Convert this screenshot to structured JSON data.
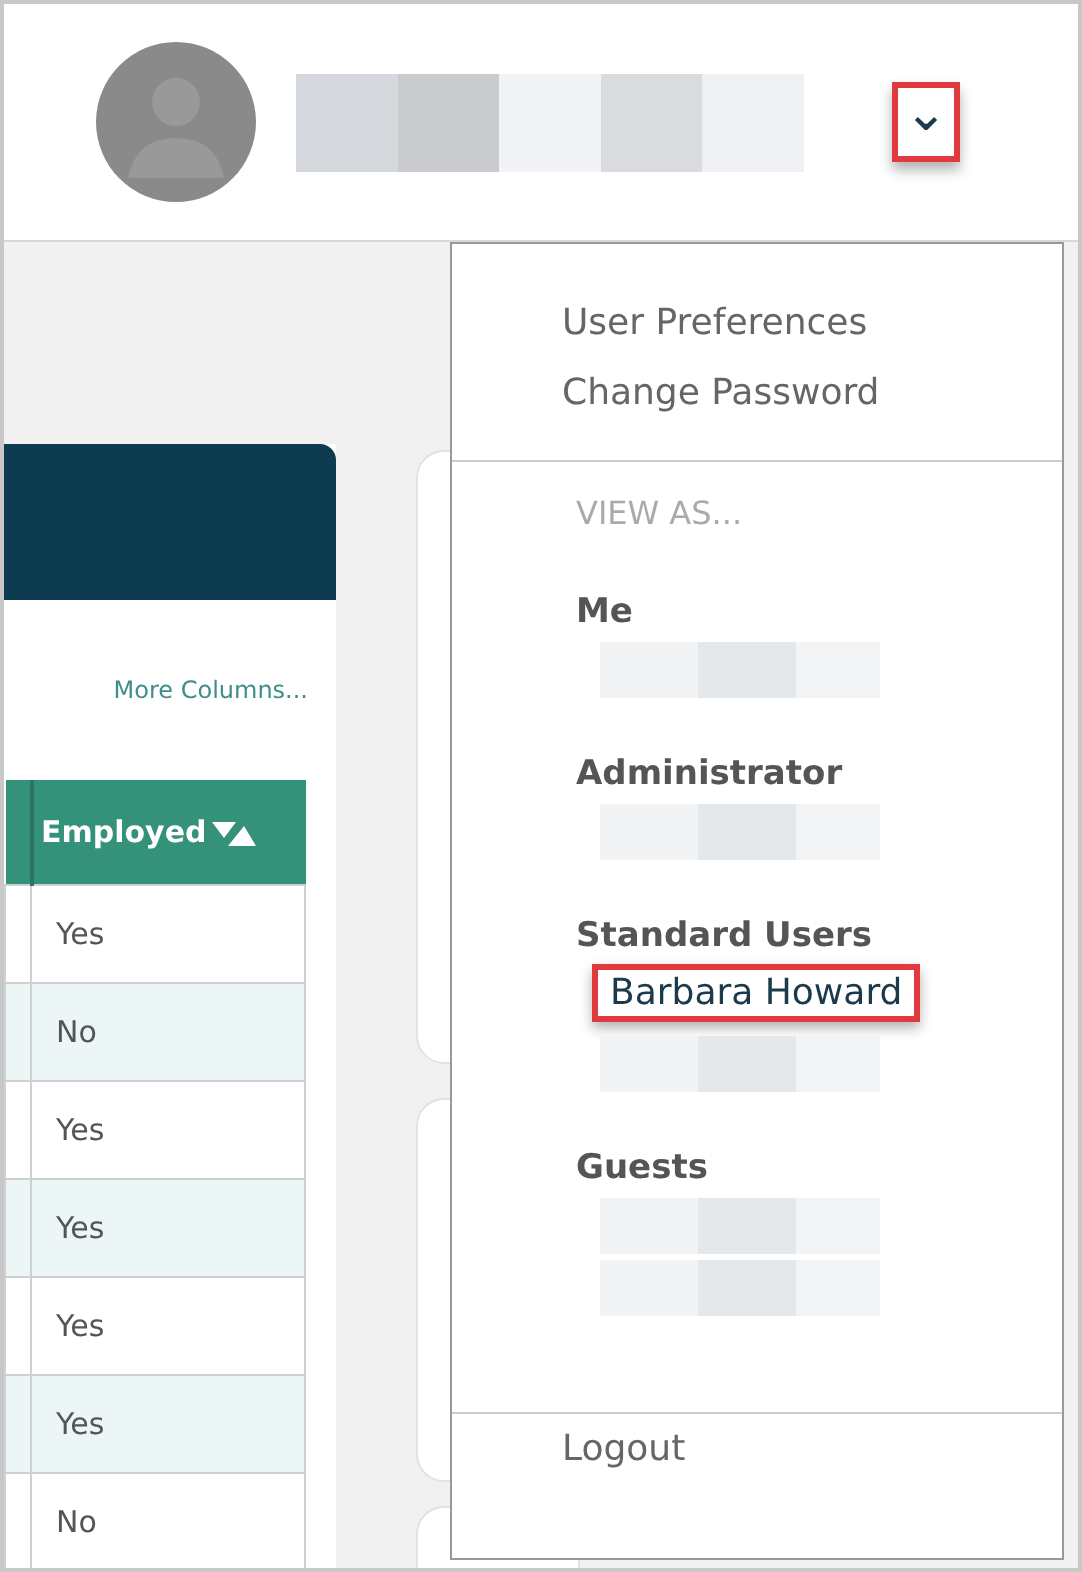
{
  "header": {
    "menu_toggle": {
      "glyph": "⌄",
      "highlighted": true
    }
  },
  "table": {
    "more_columns": "More Columns...",
    "columns": [
      {
        "kind": "stub"
      },
      {
        "label": "Employed",
        "sort_icon": true
      }
    ],
    "rows": [
      {
        "employed": "Yes"
      },
      {
        "employed": "No"
      },
      {
        "employed": "Yes"
      },
      {
        "employed": "Yes"
      },
      {
        "employed": "Yes"
      },
      {
        "employed": "Yes"
      },
      {
        "employed": "No"
      }
    ]
  },
  "dropdown": {
    "links": [
      {
        "label": "User Preferences"
      },
      {
        "label": "Change Password"
      }
    ],
    "view_as_label": "VIEW AS...",
    "groups": [
      {
        "heading": "Me",
        "users": [
          {
            "kind": "redacted"
          }
        ]
      },
      {
        "heading": "Administrator",
        "users": [
          {
            "kind": "redacted"
          }
        ]
      },
      {
        "heading": "Standard Users",
        "users": [
          {
            "kind": "name",
            "label": "Barbara Howard",
            "highlighted": true
          },
          {
            "kind": "redacted"
          }
        ]
      },
      {
        "heading": "Guests",
        "users": [
          {
            "kind": "redacted"
          },
          {
            "kind": "redacted"
          }
        ]
      }
    ],
    "logout": "Logout"
  }
}
